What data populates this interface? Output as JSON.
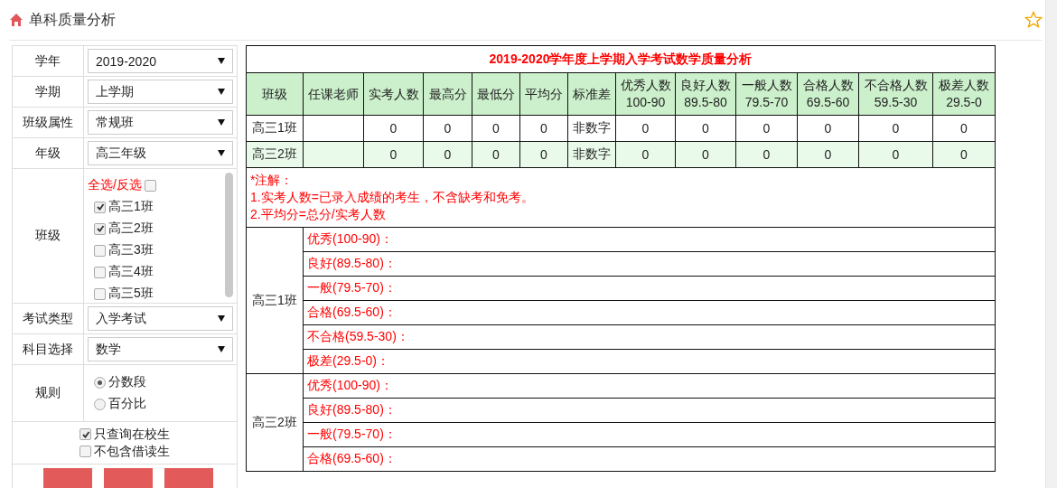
{
  "page": {
    "title": "单科质量分析"
  },
  "filters": [
    {
      "kind": "select",
      "label": "学年",
      "value": "2019-2020"
    },
    {
      "kind": "select",
      "label": "学期",
      "value": "上学期"
    },
    {
      "kind": "select",
      "label": "班级属性",
      "value": "常规班"
    },
    {
      "kind": "select",
      "label": "年级",
      "value": "高三年级"
    },
    {
      "kind": "checklist",
      "label": "班级",
      "toggle_all": {
        "label": "全选/反选",
        "checked": false
      },
      "options": [
        {
          "label": "高三1班",
          "checked": true
        },
        {
          "label": "高三2班",
          "checked": true
        },
        {
          "label": "高三3班",
          "checked": false
        },
        {
          "label": "高三4班",
          "checked": false
        },
        {
          "label": "高三5班",
          "checked": false
        }
      ]
    },
    {
      "kind": "select",
      "label": "考试类型",
      "value": "入学考试"
    },
    {
      "kind": "select",
      "label": "科目选择",
      "value": "数学"
    },
    {
      "kind": "radio",
      "label": "规则",
      "options": [
        {
          "label": "分数段",
          "selected": true
        },
        {
          "label": "百分比",
          "selected": false
        }
      ]
    }
  ],
  "options": [
    {
      "label": "只查询在校生",
      "checked": true
    },
    {
      "label": "不包含借读生",
      "checked": false
    }
  ],
  "action_buttons": [
    {
      "kind": "button"
    },
    {
      "kind": "button"
    },
    {
      "kind": "button"
    }
  ],
  "report": {
    "title": "2019-2020学年度上学期入学考试数学质量分析",
    "columns": [
      {
        "label": "班级"
      },
      {
        "label": "任课老师"
      },
      {
        "label": "实考人数"
      },
      {
        "label": "最高分"
      },
      {
        "label": "最低分"
      },
      {
        "label": "平均分"
      },
      {
        "label": "标准差"
      },
      {
        "label": "优秀人数",
        "range": "100-90"
      },
      {
        "label": "良好人数",
        "range": "89.5-80"
      },
      {
        "label": "一般人数",
        "range": "79.5-70"
      },
      {
        "label": "合格人数",
        "range": "69.5-60"
      },
      {
        "label": "不合格人数",
        "range": "59.5-30"
      },
      {
        "label": "极差人数",
        "range": "29.5-0"
      }
    ],
    "rows": [
      {
        "cells": [
          "高三1班",
          null,
          "0",
          "0",
          "0",
          "0",
          "非数字",
          "0",
          "0",
          "0",
          "0",
          "0",
          "0"
        ]
      },
      {
        "cells": [
          "高三2班",
          null,
          "0",
          "0",
          "0",
          "0",
          "非数字",
          "0",
          "0",
          "0",
          "0",
          "0",
          "0"
        ]
      }
    ],
    "notes": [
      "*注解：",
      "1.实考人数=已录入成绩的考生，不含缺考和免考。",
      "2.平均分=总分/实考人数"
    ],
    "breakdown": [
      {
        "class": "高三1班",
        "levels": [
          "优秀(100-90)：",
          "良好(89.5-80)：",
          "一般(79.5-70)：",
          "合格(69.5-60)：",
          "不合格(59.5-30)：",
          "极差(29.5-0)："
        ]
      },
      {
        "class": "高三2班",
        "levels": [
          "优秀(100-90)：",
          "良好(89.5-80)：",
          "一般(79.5-70)：",
          "合格(69.5-60)："
        ]
      }
    ]
  }
}
